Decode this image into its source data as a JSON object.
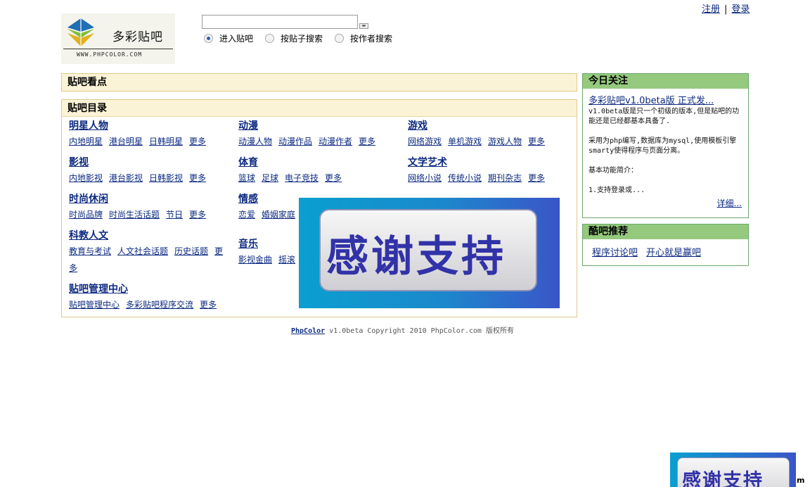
{
  "top_links": {
    "register": "注册",
    "separator": "|",
    "login": "登录"
  },
  "logo": {
    "name": "多彩贴吧",
    "url": "WWW.PHPCOLOR.COM"
  },
  "search": {
    "input_value": "",
    "button_icon": "search-button-icon",
    "options": [
      {
        "label": "进入贴吧",
        "selected": true
      },
      {
        "label": "按贴子搜索",
        "selected": false
      },
      {
        "label": "按作者搜索",
        "selected": false
      }
    ]
  },
  "kan": {
    "title": "贴吧看点"
  },
  "directory": {
    "title": "贴吧目录",
    "categories": [
      {
        "title": "明星人物",
        "subs": [
          "内地明星",
          "港台明星",
          "日韩明星",
          "更多"
        ]
      },
      {
        "title": "动漫",
        "subs": [
          "动漫人物",
          "动漫作品",
          "动漫作者",
          "更多"
        ]
      },
      {
        "title": "游戏",
        "subs": [
          "网络游戏",
          "单机游戏",
          "游戏人物",
          "更多"
        ]
      },
      {
        "title": "影视",
        "subs": [
          "内地影视",
          "港台影视",
          "日韩影视",
          "更多"
        ]
      },
      {
        "title": "体育",
        "subs": [
          "篮球",
          "足球",
          "电子竞技",
          "更多"
        ]
      },
      {
        "title": "文学艺术",
        "subs": [
          "网络小说",
          "传统小说",
          "期刊杂志",
          "更多"
        ]
      },
      {
        "title": "时尚休闲",
        "subs": [
          "时尚品牌",
          "时尚生活话题",
          "节日",
          "更多"
        ]
      },
      {
        "title": "情感",
        "subs": [
          "恋爱",
          "婚姻家庭"
        ]
      },
      {
        "title": "科教人文",
        "subs": [
          "教育与考试",
          "人文社会话题",
          "历史话题",
          "更多"
        ]
      },
      {
        "title": "音乐",
        "subs": [
          "影视金曲",
          "摇滚"
        ]
      },
      {
        "title": "贴吧管理中心",
        "subs": [
          "贴吧管理中心",
          "多彩贴吧程序交流",
          "更多"
        ]
      }
    ]
  },
  "overlay": {
    "text": "感谢支持",
    "small_suffix": "m"
  },
  "footer": {
    "brand": "PhpColor",
    "text": " v1.0beta Copyright 2010 PhpColor.com 版权所有"
  },
  "today": {
    "title": "今日关注",
    "news_title": "多彩贴吧v1.0beta版 正式发...",
    "news_body": "v1.0beta版是只一个初级的版本,但是贴吧的功能还是已经都基本具备了.\n\n采用为php编写,数据库为mysql,使用模板引擎smarty使得程序与页面分离。\n\n基本功能简介：\n\n1.支持登录或...",
    "more": "详细..."
  },
  "recommend": {
    "title": "酷吧推荐",
    "links": [
      "程序讨论吧",
      "开心就是赢吧"
    ]
  }
}
